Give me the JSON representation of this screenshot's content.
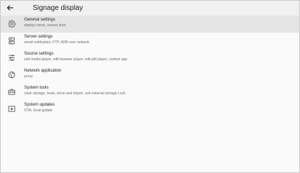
{
  "header": {
    "title": "Signage display"
  },
  "menu": [
    {
      "icon": "gear-icon",
      "title": "General settings",
      "subtitle": "display name, screen shot",
      "selected": true
    },
    {
      "icon": "server-icon",
      "title": "Server settings",
      "subtitle": "email notification, FTP, ADB over network",
      "selected": false
    },
    {
      "icon": "sliders-icon",
      "title": "Source settings",
      "subtitle": "edit media player, edit browser player, edit pdf player, custom app",
      "selected": false
    },
    {
      "icon": "network-icon",
      "title": "Network application",
      "subtitle": "proxy",
      "selected": false
    },
    {
      "icon": "toolbox-icon",
      "title": "System tools",
      "subtitle": "clear storage, reset, clone and import, usb external storage Lock",
      "selected": false
    },
    {
      "icon": "system-update-icon",
      "title": "System updates",
      "subtitle": "OTA, local update",
      "selected": false
    }
  ],
  "colors": {
    "header_bg": "#f1f1f1",
    "selected_bg": "#e5e5e5",
    "page_bg": "#fafafa"
  }
}
